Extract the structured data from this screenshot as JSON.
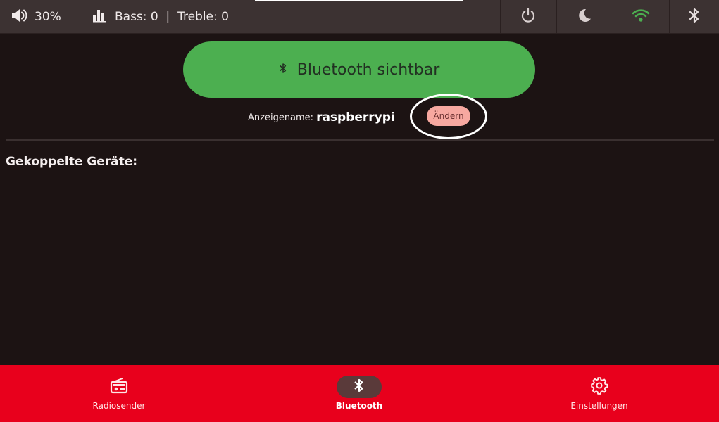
{
  "status": {
    "volume": "30%",
    "bass_treble": "Bass: 0  |  Treble: 0"
  },
  "quick_actions": {
    "icons": [
      "power-icon",
      "moon-icon",
      "wifi-icon",
      "bluetooth-icon"
    ],
    "wifi_color": "#4caf50"
  },
  "bluetooth": {
    "visibility_button": "Bluetooth sichtbar",
    "display_name_label": "Anzeigename:",
    "display_name": "raspberrypi",
    "change_button": "Ändern",
    "paired_devices_title": "Gekoppelte Geräte:"
  },
  "nav": {
    "items": [
      {
        "label": "Radiosender",
        "icon": "radio-icon"
      },
      {
        "label": "Bluetooth",
        "icon": "bluetooth-icon",
        "active": true
      },
      {
        "label": "Einstellungen",
        "icon": "gear-icon"
      }
    ]
  },
  "colors": {
    "accent_green": "#4caf50",
    "nav_red": "#e8001c",
    "change_button_pink": "#f7a8a0"
  }
}
